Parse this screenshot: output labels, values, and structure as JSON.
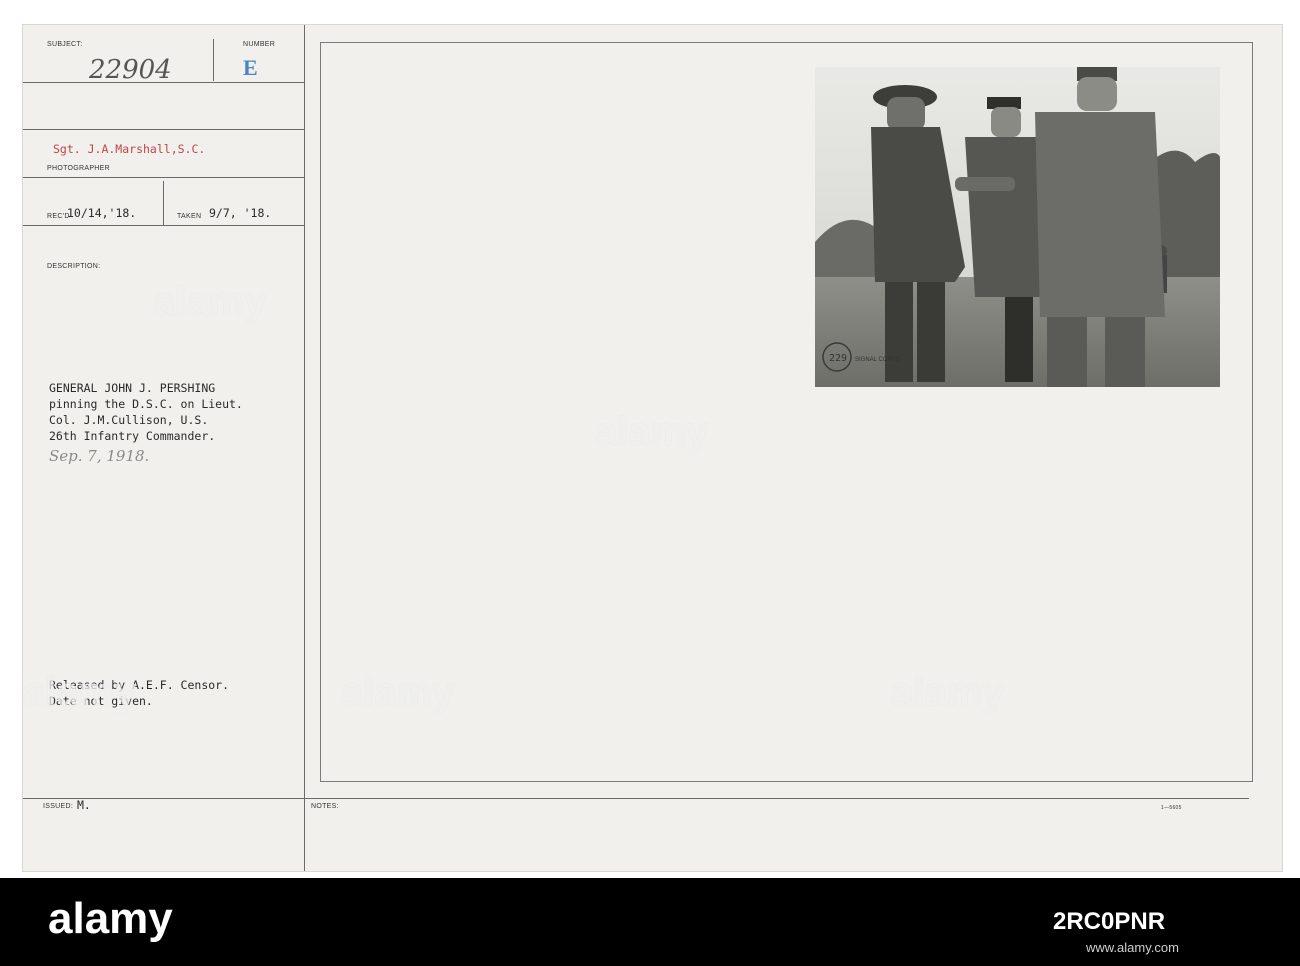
{
  "record": {
    "subject_label": "SUBJECT:",
    "subject_value": "22904",
    "number_label": "NUMBER",
    "number_value": "E",
    "photographer_value": "Sgt. J.A.Marshall,S.C.",
    "photographer_label": "PHOTOGRAPHER",
    "recd_label": "REC'D",
    "recd_value": "10/14,'18.",
    "taken_label": "TAKEN",
    "taken_value": "9/7, '18.",
    "description_label": "DESCRIPTION:",
    "description_lines": [
      "GENERAL JOHN J. PERSHING",
      "pinning the D.S.C. on Lieut.",
      "Col. J.M.Cullison, U.S.",
      "26th Infantry Commander."
    ],
    "handwritten_date": "Sep. 7, 1918.",
    "release_lines": [
      "Released by A.E.F. Censor.",
      "Date not given."
    ],
    "issued_label": "ISSUED:",
    "issued_value": "M.",
    "notes_label": "NOTES:",
    "form_number": "1—5605"
  },
  "photo": {
    "stamp_text": "SIGNAL CORPS",
    "stamp_number": "229"
  },
  "watermark": "alamy",
  "footer": {
    "logo": "alamy",
    "image_id": "2RC0PNR",
    "url": "www.alamy.com"
  }
}
